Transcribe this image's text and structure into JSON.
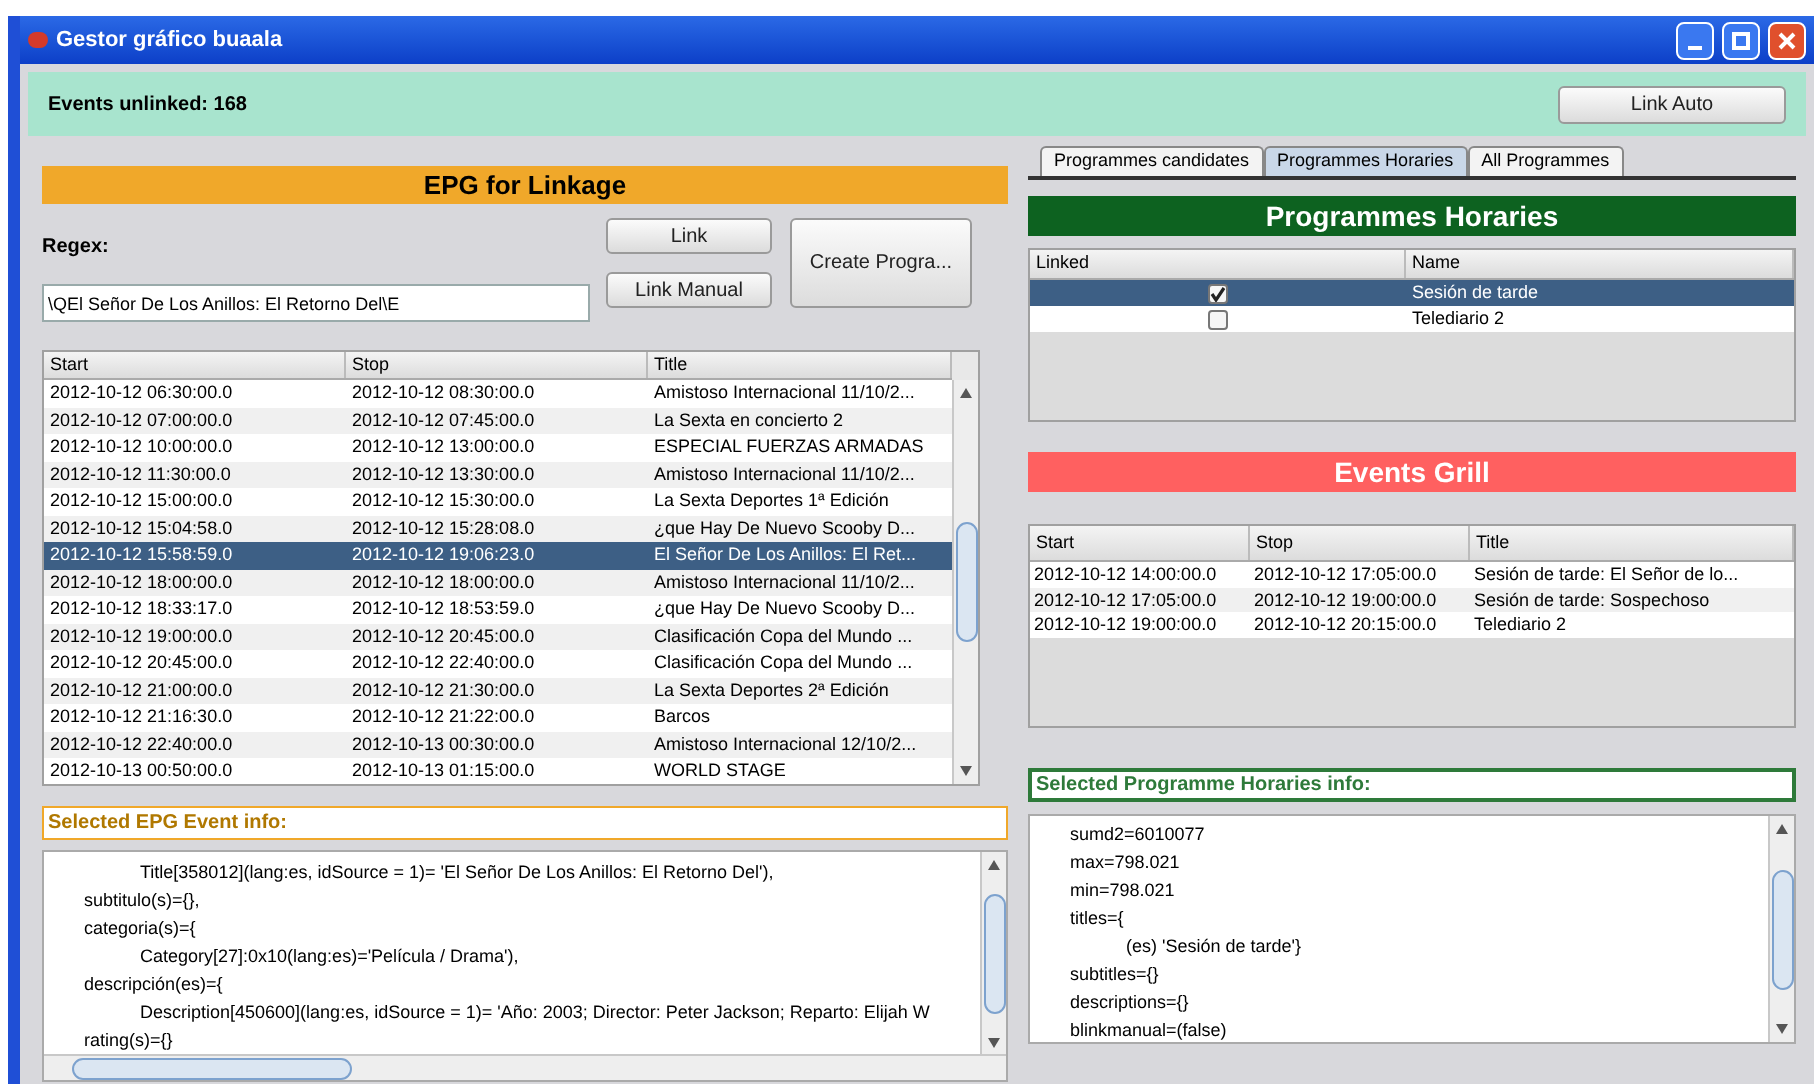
{
  "window": {
    "title": "Gestor gráfico buaala"
  },
  "status": {
    "label": "Events unlinked: 168"
  },
  "link_auto_button": "Link Auto",
  "epg": {
    "title": "EPG for Linkage",
    "regex_label": "Regex:",
    "regex_value": "\\QEl Señor De Los Anillos: El Retorno Del\\E",
    "buttons": {
      "link": "Link",
      "link_manual": "Link Manual",
      "create": "Create Progra..."
    },
    "columns": [
      "Start",
      "Stop",
      "Title"
    ],
    "rows": [
      {
        "start": "2012-10-12 06:30:00.0",
        "stop": "2012-10-12 08:30:00.0",
        "title": "Amistoso Internacional 11/10/2...",
        "selected": false
      },
      {
        "start": "2012-10-12 07:00:00.0",
        "stop": "2012-10-12 07:45:00.0",
        "title": "La Sexta en concierto 2",
        "selected": false
      },
      {
        "start": "2012-10-12 10:00:00.0",
        "stop": "2012-10-12 13:00:00.0",
        "title": "ESPECIAL FUERZAS ARMADAS",
        "selected": false
      },
      {
        "start": "2012-10-12 11:30:00.0",
        "stop": "2012-10-12 13:30:00.0",
        "title": "Amistoso Internacional 11/10/2...",
        "selected": false
      },
      {
        "start": "2012-10-12 15:00:00.0",
        "stop": "2012-10-12 15:30:00.0",
        "title": "La Sexta Deportes 1ª Edición",
        "selected": false
      },
      {
        "start": "2012-10-12 15:04:58.0",
        "stop": "2012-10-12 15:28:08.0",
        "title": "¿que Hay De Nuevo Scooby D...",
        "selected": false
      },
      {
        "start": "2012-10-12 15:58:59.0",
        "stop": "2012-10-12 19:06:23.0",
        "title": "El Señor De Los Anillos: El Ret...",
        "selected": true
      },
      {
        "start": "2012-10-12 18:00:00.0",
        "stop": "2012-10-12 18:00:00.0",
        "title": "Amistoso Internacional 11/10/2...",
        "selected": false
      },
      {
        "start": "2012-10-12 18:33:17.0",
        "stop": "2012-10-12 18:53:59.0",
        "title": "¿que Hay De Nuevo Scooby D...",
        "selected": false
      },
      {
        "start": "2012-10-12 19:00:00.0",
        "stop": "2012-10-12 20:45:00.0",
        "title": "Clasificación Copa del Mundo ...",
        "selected": false
      },
      {
        "start": "2012-10-12 20:45:00.0",
        "stop": "2012-10-12 22:40:00.0",
        "title": "Clasificación Copa del Mundo ...",
        "selected": false
      },
      {
        "start": "2012-10-12 21:00:00.0",
        "stop": "2012-10-12 21:30:00.0",
        "title": "La Sexta Deportes 2ª Edición",
        "selected": false
      },
      {
        "start": "2012-10-12 21:16:30.0",
        "stop": "2012-10-12 21:22:00.0",
        "title": "Barcos",
        "selected": false
      },
      {
        "start": "2012-10-12 22:40:00.0",
        "stop": "2012-10-13 00:30:00.0",
        "title": "Amistoso Internacional 12/10/2...",
        "selected": false
      },
      {
        "start": "2012-10-13 00:50:00.0",
        "stop": "2012-10-13 01:15:00.0",
        "title": "WORLD STAGE",
        "selected": false
      }
    ],
    "info_title": "Selected EPG Event info:",
    "info_lines": [
      {
        "kind": "nested",
        "text": "Title[358012](lang:es, idSource = 1)= 'El Señor De Los Anillos: El Retorno Del'),"
      },
      {
        "kind": "top",
        "text": "subtitulo(s)={},"
      },
      {
        "kind": "top",
        "text": "categoria(s)={"
      },
      {
        "kind": "nested",
        "text": "Category[27]:0x10(lang:es)='Película / Drama'),"
      },
      {
        "kind": "top",
        "text": "descripción(es)={"
      },
      {
        "kind": "nested",
        "text": "Description[450600](lang:es, idSource = 1)= 'Año: 2003; Director: Peter Jackson; Reparto: Elijah W"
      },
      {
        "kind": "top",
        "text": "rating(s)={}"
      }
    ]
  },
  "tabs": [
    {
      "label": "Programmes candidates",
      "selected": false
    },
    {
      "label": "Programmes Horaries",
      "selected": true
    },
    {
      "label": "All Programmes",
      "selected": false
    }
  ],
  "programmes": {
    "title": "Programmes Horaries",
    "columns": [
      "Linked",
      "Name"
    ],
    "rows": [
      {
        "name": "Sesión de tarde",
        "checked": true,
        "selected": true
      },
      {
        "name": "Telediario 2",
        "checked": false,
        "selected": false
      }
    ]
  },
  "events_grill": {
    "title": "Events Grill",
    "columns": [
      "Start",
      "Stop",
      "Title"
    ],
    "rows": [
      {
        "start": "2012-10-12 14:00:00.0",
        "stop": "2012-10-12 17:05:00.0",
        "title": "Sesión de tarde: El Señor de lo..."
      },
      {
        "start": "2012-10-12 17:05:00.0",
        "stop": "2012-10-12 19:00:00.0",
        "title": "Sesión de tarde: Sospechoso"
      },
      {
        "start": "2012-10-12 19:00:00.0",
        "stop": "2012-10-12 20:15:00.0",
        "title": "Telediario 2"
      }
    ]
  },
  "programme_info": {
    "title": "Selected Programme Horaries info:",
    "lines": [
      {
        "kind": "top",
        "text": "sumd2=6010077"
      },
      {
        "kind": "top",
        "text": "max=798.021"
      },
      {
        "kind": "top",
        "text": "min=798.021"
      },
      {
        "kind": "top",
        "text": "titles={"
      },
      {
        "kind": "nested",
        "text": "(es) 'Sesión de tarde'}"
      },
      {
        "kind": "top",
        "text": "subtitles={}"
      },
      {
        "kind": "top",
        "text": "descriptions={}"
      },
      {
        "kind": "top",
        "text": "blinkmanual=(false)"
      }
    ]
  }
}
